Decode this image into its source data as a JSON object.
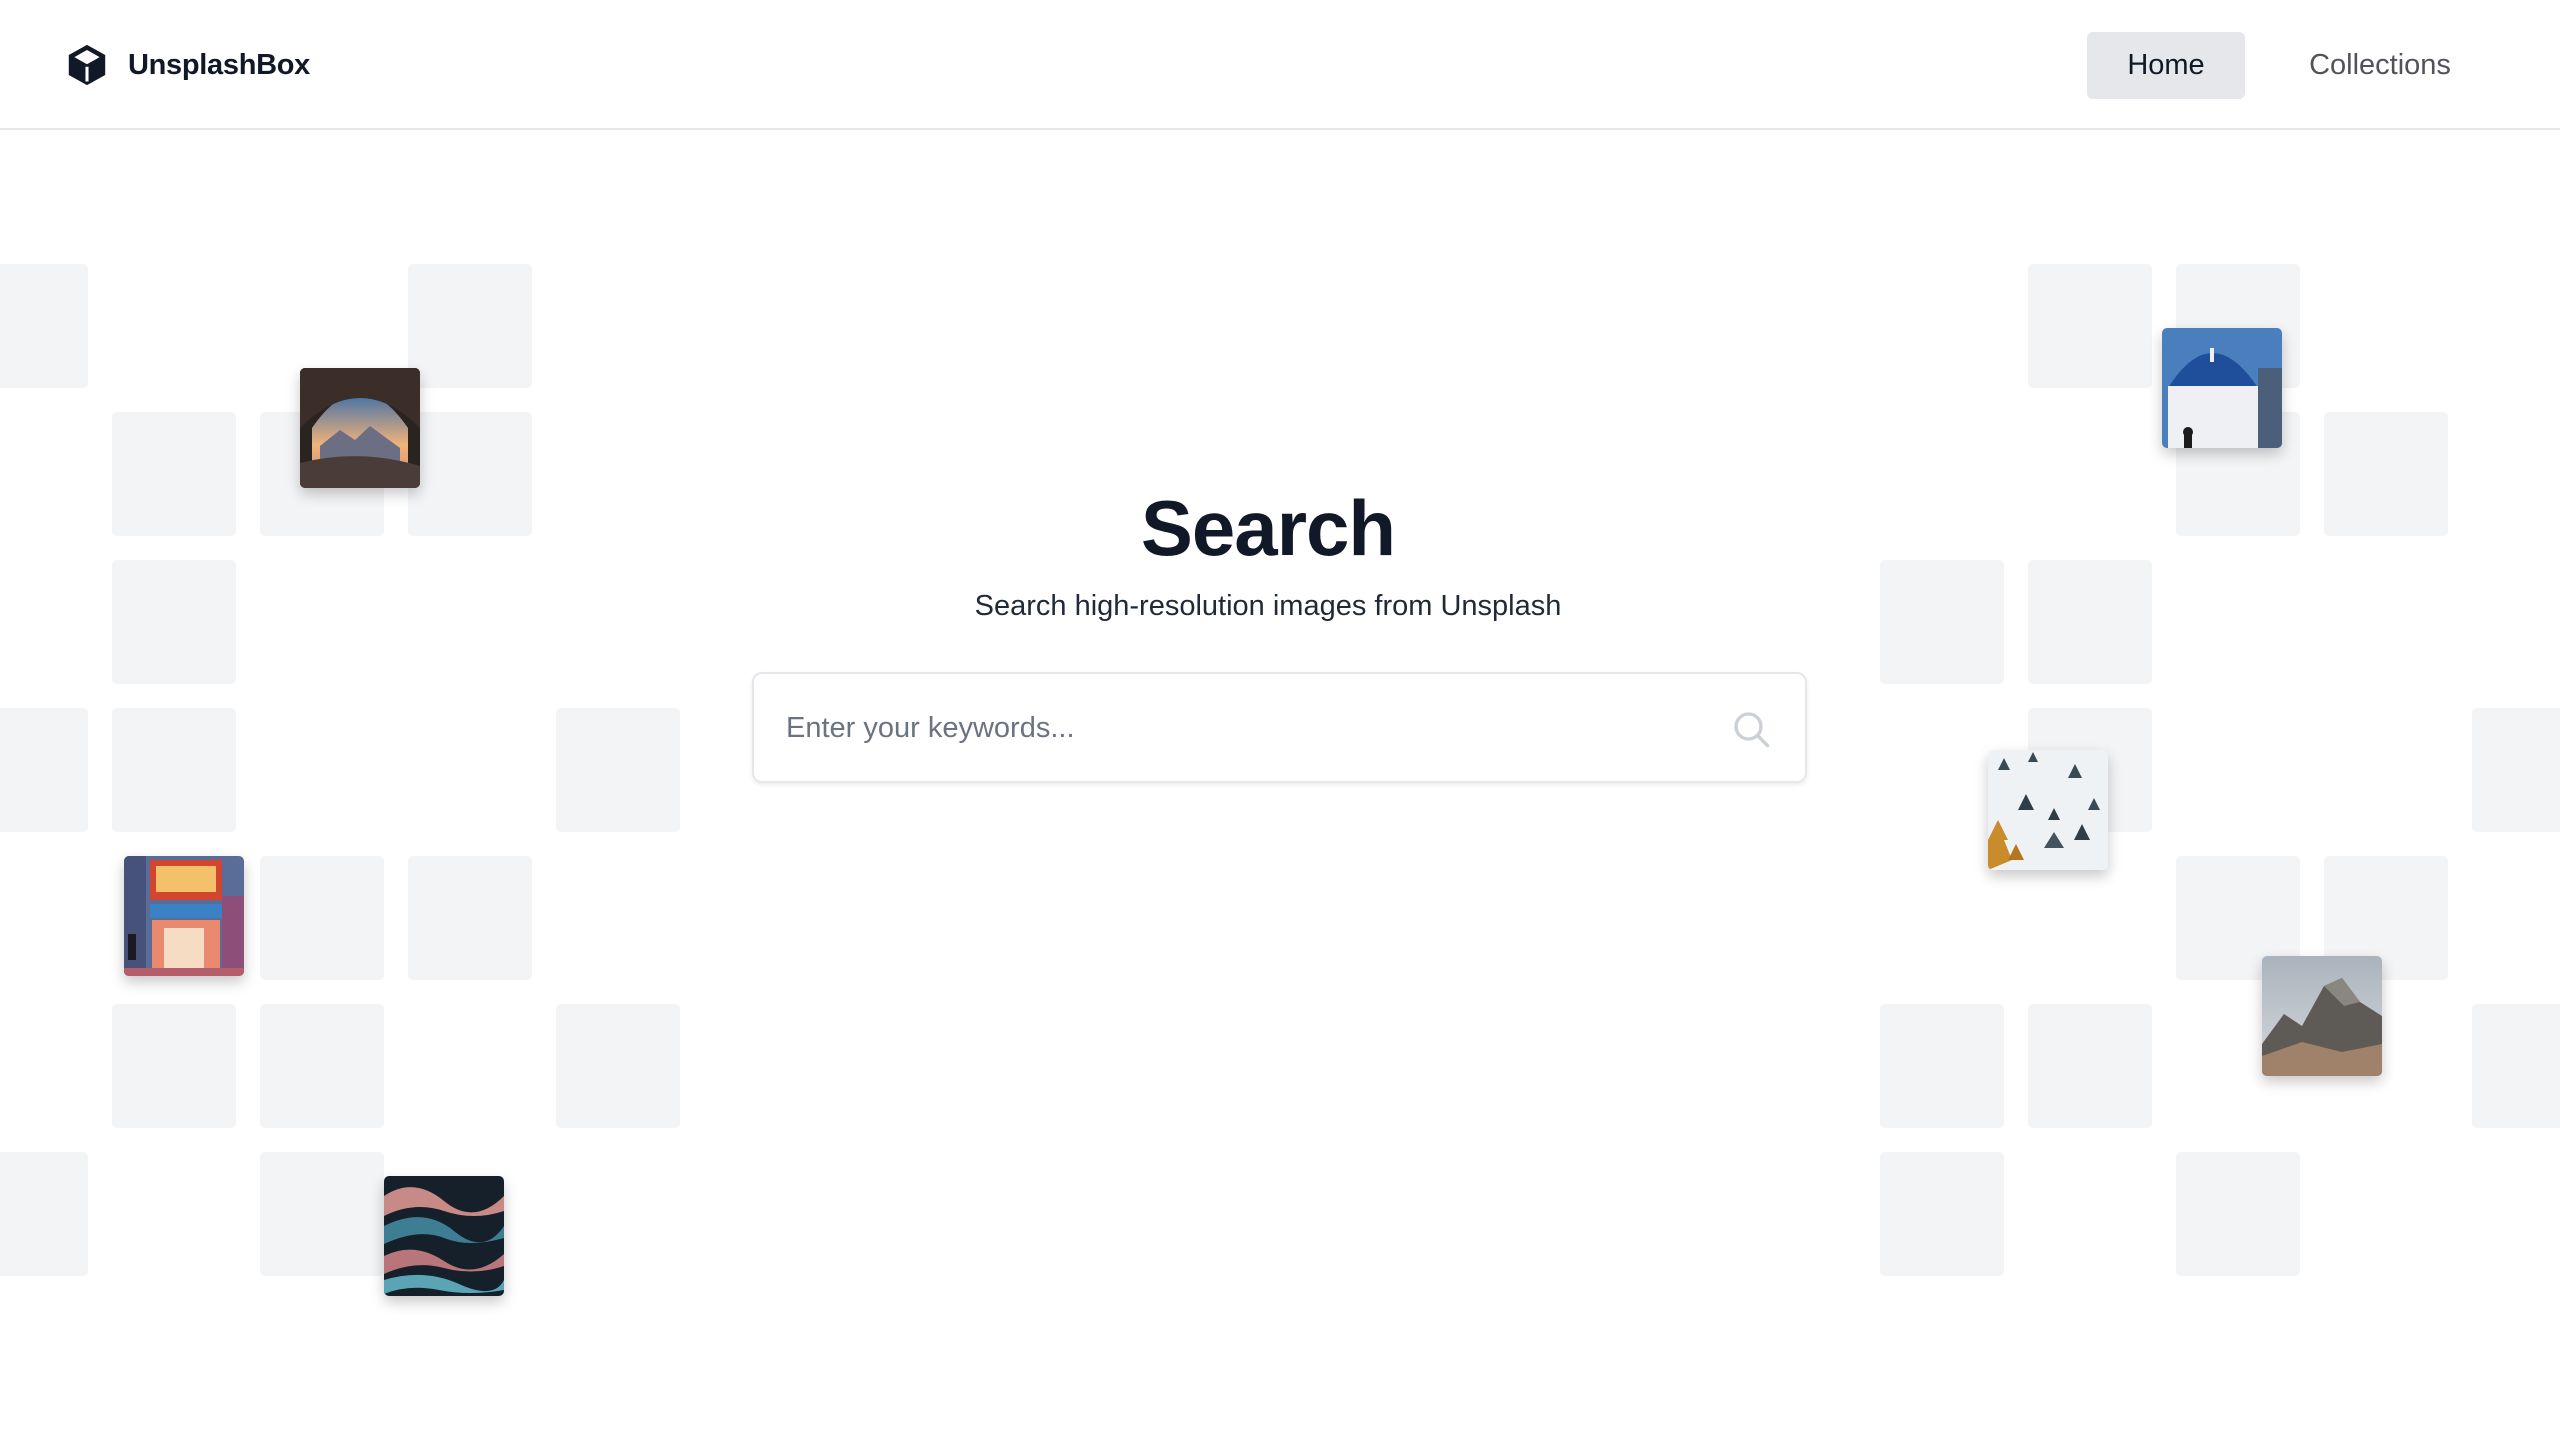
{
  "header": {
    "brand": "UnsplashBox",
    "brand_icon": "cube-icon",
    "nav": {
      "home": "Home",
      "collections": "Collections"
    }
  },
  "hero": {
    "title": "Search",
    "subtitle": "Search high-resolution images from Unsplash",
    "search": {
      "placeholder": "Enter your keywords...",
      "value": "",
      "icon": "search-icon"
    }
  },
  "colors": {
    "text": "#111827",
    "muted": "#6b7280",
    "tile": "#f3f4f6",
    "nav_active_bg": "#e5e7eb",
    "border": "#e5e7eb"
  }
}
